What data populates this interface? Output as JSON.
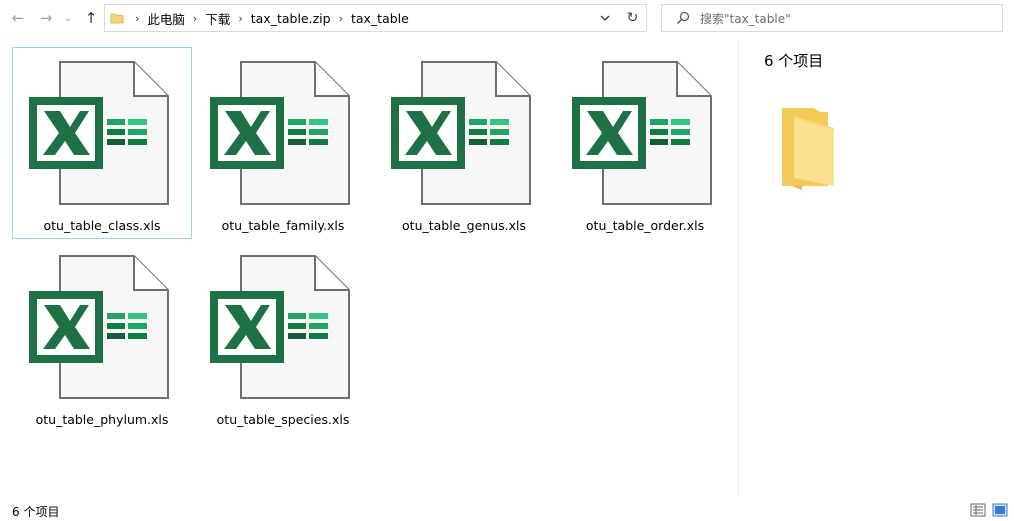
{
  "breadcrumb": [
    "此电脑",
    "下载",
    "tax_table.zip",
    "tax_table"
  ],
  "search": {
    "placeholder": "搜索\"tax_table\""
  },
  "files": [
    {
      "name": "otu_table_class.xls",
      "selected": true
    },
    {
      "name": "otu_table_family.xls"
    },
    {
      "name": "otu_table_genus.xls"
    },
    {
      "name": "otu_table_order.xls"
    },
    {
      "name": "otu_table_phylum.xls"
    },
    {
      "name": "otu_table_species.xls"
    }
  ],
  "preview": {
    "count_label": "6 个项目"
  },
  "status": {
    "count_label": "6 个项目"
  },
  "icons": {
    "back": "arrow-left-icon",
    "forward": "arrow-right-icon",
    "recent": "chevron-down-icon",
    "up": "arrow-up-icon",
    "refresh": "refresh-icon",
    "search": "search-icon",
    "file": "excel-file-icon"
  },
  "colors": {
    "excel_green": "#1e7145",
    "selection_border": "#99d1ff"
  }
}
